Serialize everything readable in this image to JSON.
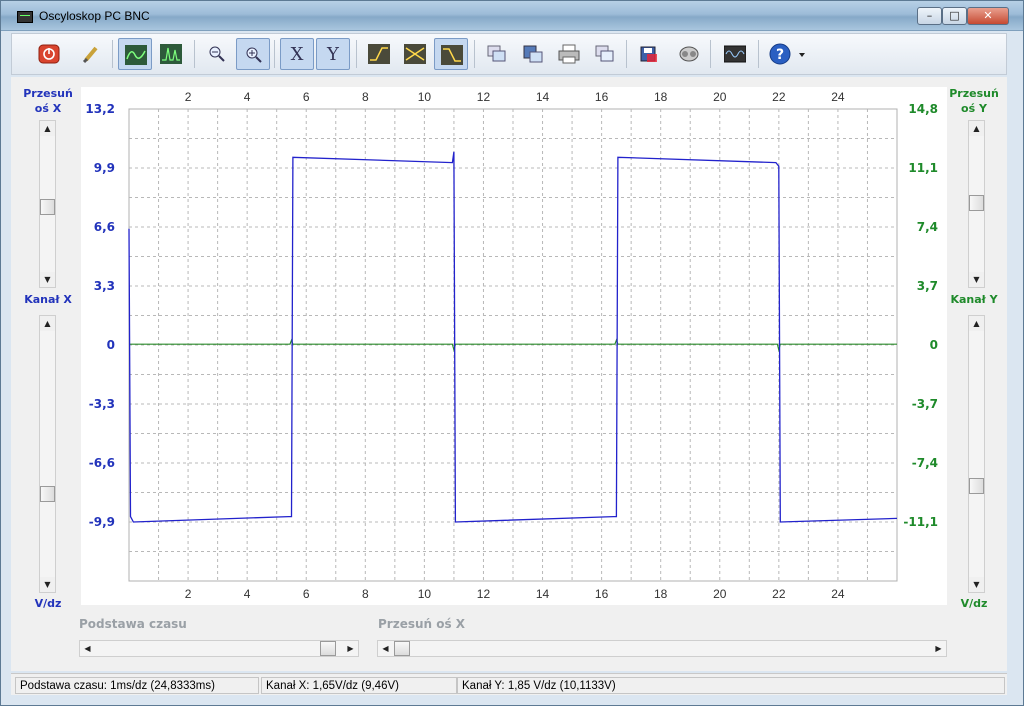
{
  "window": {
    "title": "Oscyloskop PC BNC",
    "minimize": "–",
    "maximize": "□",
    "close": "✕"
  },
  "toolbar": {
    "buttons": [
      {
        "name": "power-icon"
      },
      {
        "name": "brush-icon"
      },
      {
        "name": "waveform-line-icon",
        "active": true
      },
      {
        "name": "waveform-spectrum-icon"
      },
      {
        "name": "zoom-out-icon"
      },
      {
        "name": "zoom-in-icon",
        "active": true
      },
      {
        "label": "X",
        "active": true
      },
      {
        "label": "Y",
        "active": true
      },
      {
        "name": "trigger-rising-icon"
      },
      {
        "name": "trigger-cross-icon"
      },
      {
        "name": "trigger-falling-icon",
        "active": true
      },
      {
        "name": "copy-image-icon"
      },
      {
        "name": "save-image-icon"
      },
      {
        "name": "print-icon"
      },
      {
        "name": "copy-data-icon"
      },
      {
        "name": "save-data-icon"
      },
      {
        "name": "record-icon"
      },
      {
        "name": "generator-icon"
      },
      {
        "name": "help-icon"
      }
    ]
  },
  "left_panel": {
    "offset_label_1": "Przesuń",
    "offset_label_2": "oś X",
    "channel_label": "Kanał X",
    "unit_label": "V/dz"
  },
  "right_panel": {
    "offset_label_1": "Przesuń",
    "offset_label_2": "oś Y",
    "channel_label": "Kanał Y",
    "unit_label": "V/dz"
  },
  "bottom": {
    "timebase_label": "Podstawa czasu",
    "shift_x_label": "Przesuń oś X"
  },
  "status": {
    "timebase": "Podstawa czasu: 1ms/dz (24,8333ms)",
    "channel_x": "Kanał X: 1,65V/dz (9,46V)",
    "channel_y": "Kanał Y: 1,85 V/dz (10,1133V)"
  },
  "chart_data": {
    "type": "line",
    "x_ticks": [
      "2",
      "4",
      "6",
      "8",
      "10",
      "12",
      "14",
      "16",
      "18",
      "20",
      "22",
      "24"
    ],
    "xlim": [
      0,
      26
    ],
    "y_left_ticks": [
      "13,2",
      "9,9",
      "6,6",
      "3,3",
      "0",
      "-3,3",
      "-6,6",
      "-9,9"
    ],
    "y_left_lim": [
      -13.2,
      13.2
    ],
    "y_right_ticks": [
      "14,8",
      "11,1",
      "7,4",
      "3,7",
      "0",
      "-3,7",
      "-7,4",
      "-11,1"
    ],
    "y_right_lim": [
      -14.8,
      14.8
    ],
    "grid": true,
    "colors": {
      "channel_x": "#2222cc",
      "channel_y": "#2a8a2a",
      "left_axis": "#2233bb",
      "right_axis": "#1e8a2a"
    },
    "series": [
      {
        "axis": "left",
        "x": [
          0,
          0.05,
          0.15,
          5.4,
          5.5,
          5.55,
          10.95,
          11.0,
          11.05,
          16.4,
          16.5,
          16.55,
          21.9,
          22.0,
          22.05,
          26
        ],
        "y": [
          6.5,
          -9.6,
          -9.9,
          -9.6,
          -9.6,
          10.5,
          10.2,
          10.8,
          -9.9,
          -9.6,
          -9.6,
          10.5,
          10.2,
          10.0,
          -9.9,
          -9.7
        ]
      },
      {
        "axis": "right",
        "x": [
          0,
          5.45,
          5.5,
          5.55,
          10.95,
          11.0,
          11.05,
          16.45,
          16.5,
          16.55,
          21.95,
          22.0,
          22.05,
          26
        ],
        "y": [
          0.05,
          0.05,
          0.3,
          0.05,
          0.05,
          -0.3,
          0.05,
          0.05,
          0.3,
          0.05,
          0.05,
          -0.3,
          0.05,
          0.05
        ]
      }
    ]
  }
}
